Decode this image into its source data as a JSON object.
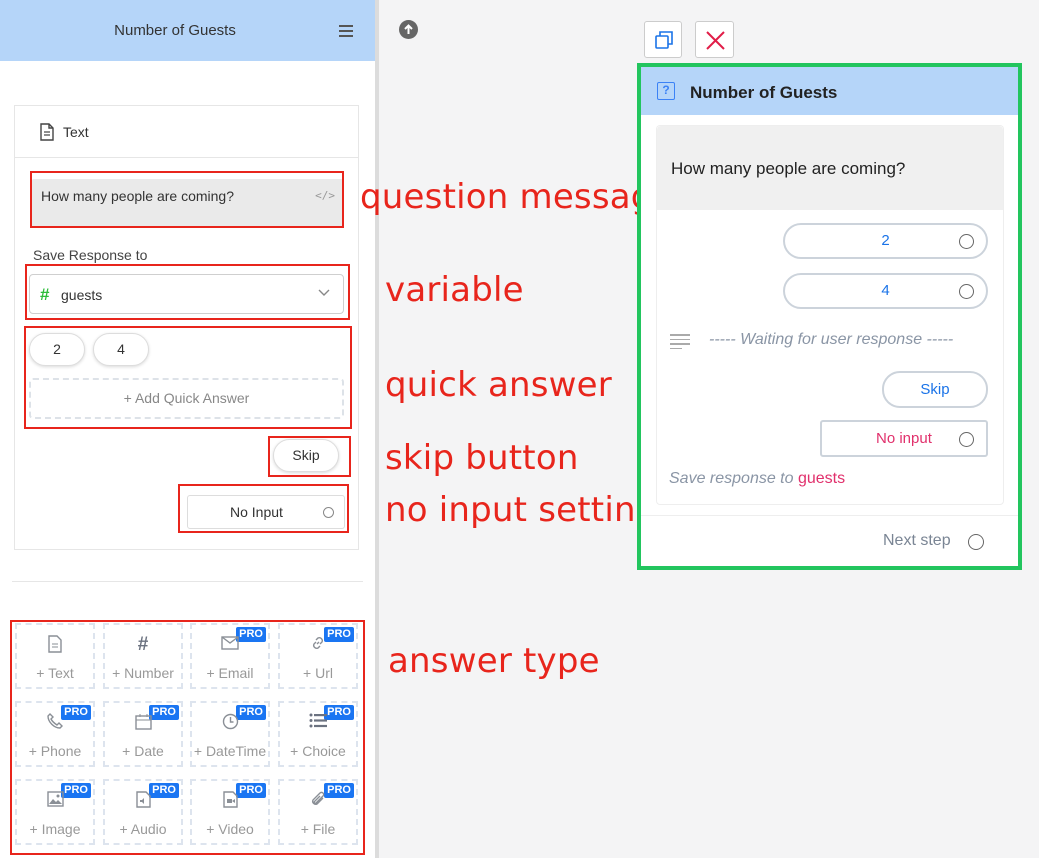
{
  "left_panel": {
    "title": "Number of Guests",
    "tab_label": "Text",
    "question": "How many people are coming?",
    "code_icon": "</>",
    "save_response_label": "Save Response to",
    "variable": "guests",
    "quick_answers": [
      "2",
      "4"
    ],
    "add_quick_answer": "+ Add Quick Answer",
    "skip_label": "Skip",
    "no_input_label": "No Input",
    "answer_types": [
      {
        "label": "+ Text",
        "icon": "document-icon",
        "pro": false
      },
      {
        "label": "+ Number",
        "icon": "hash-icon",
        "pro": false
      },
      {
        "label": "+ Email",
        "icon": "mail-icon",
        "pro": true
      },
      {
        "label": "+ Url",
        "icon": "link-icon",
        "pro": true
      },
      {
        "label": "+ Phone",
        "icon": "phone-icon",
        "pro": true
      },
      {
        "label": "+ Date",
        "icon": "calendar-icon",
        "pro": true
      },
      {
        "label": "+ DateTime",
        "icon": "clock-icon",
        "pro": true
      },
      {
        "label": "+ Choice",
        "icon": "list-icon",
        "pro": true
      },
      {
        "label": "+ Image",
        "icon": "image-icon",
        "pro": true
      },
      {
        "label": "+ Audio",
        "icon": "audio-icon",
        "pro": true
      },
      {
        "label": "+ Video",
        "icon": "video-icon",
        "pro": true
      },
      {
        "label": "+ File",
        "icon": "paperclip-icon",
        "pro": true
      }
    ],
    "pro_badge": "PRO"
  },
  "annotations": {
    "question_message": "question message",
    "variable": "variable",
    "quick_answer": "quick answer",
    "skip_button": "skip button",
    "no_input_setting": "no input setting",
    "answer_type": "answer type"
  },
  "preview": {
    "title": "Number of Guests",
    "help_icon": "?",
    "question": "How many people are coming?",
    "quick_answers": [
      "2",
      "4"
    ],
    "waiting_text": "----- Waiting for user response -----",
    "skip_label": "Skip",
    "no_input_label": "No input",
    "save_response_label": "Save response to",
    "save_response_var": "guests",
    "next_step_label": "Next step"
  },
  "colors": {
    "header_bg": "#b5d5f9",
    "annotation_red": "#e8251c",
    "preview_border": "#22c55e",
    "variable_accent": "#2ebd3a",
    "link_blue": "#1a73e8",
    "pink": "#e1306c",
    "pro_badge": "#1a75f2"
  }
}
